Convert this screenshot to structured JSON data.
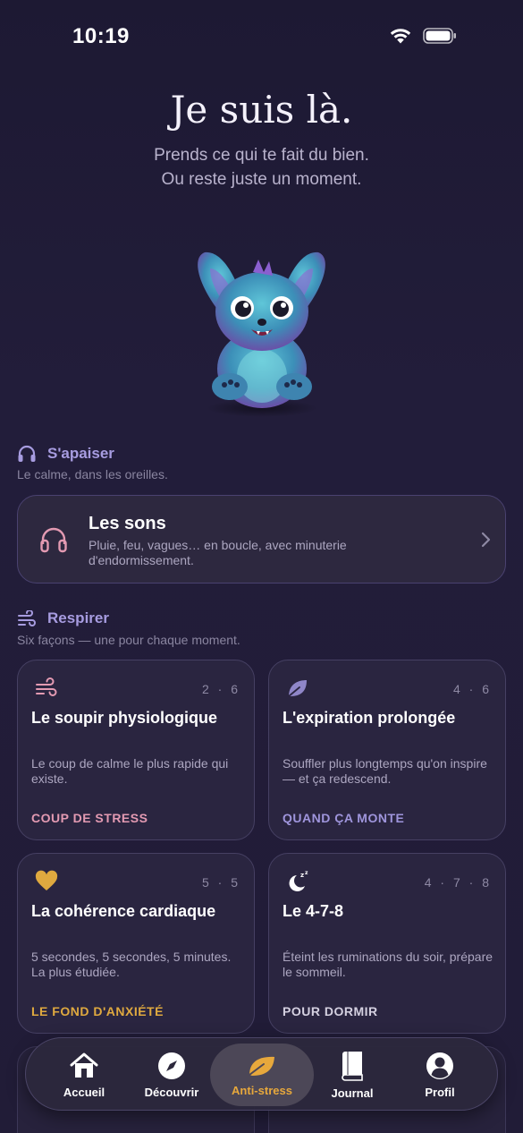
{
  "status": {
    "time": "10:19"
  },
  "hero": {
    "title": "Je suis là.",
    "subtitle_line1": "Prends ce qui te fait du bien.",
    "subtitle_line2": "Ou reste juste un moment."
  },
  "section_soothe": {
    "title": "S'apaiser",
    "subtitle": "Le calme, dans les oreilles.",
    "icon": "headphones-icon"
  },
  "sounds_card": {
    "title": "Les sons",
    "description": "Pluie, feu, vagues… en boucle, avec minuterie d'endormissement."
  },
  "section_breathe": {
    "title": "Respirer",
    "subtitle": "Six façons — une pour chaque moment.",
    "icon": "wind-icon"
  },
  "exercises": [
    {
      "title": "Le soupir physiologique",
      "rhythm": "2 · 6",
      "description": "Le coup de calme le plus rapide qui existe.",
      "tag": "COUP DE STRESS",
      "icon": "wind-icon",
      "tag_color": "#e39ab2"
    },
    {
      "title": "L'expiration prolongée",
      "rhythm": "4 · 6",
      "description": "Souffler plus longtemps qu'on inspire — et ça redescend.",
      "tag": "QUAND ÇA MONTE",
      "icon": "leaf-icon",
      "tag_color": "#9f95dc"
    },
    {
      "title": "La cohérence cardiaque",
      "rhythm": "5 · 5",
      "description": "5 secondes, 5 secondes, 5 minutes. La plus étudiée.",
      "tag": "LE FOND D'ANXIÉTÉ",
      "icon": "heart-icon",
      "tag_color": "#dfa93f"
    },
    {
      "title": "Le 4-7-8",
      "rhythm": "4 · 7 · 8",
      "description": "Éteint les ruminations du soir, prépare le sommeil.",
      "tag": "POUR DORMIR",
      "icon": "moon-sleep-icon",
      "tag_color": "#d4d0e0"
    }
  ],
  "tabbar": {
    "items": [
      {
        "label": "Accueil",
        "icon": "home-icon"
      },
      {
        "label": "Découvrir",
        "icon": "compass-icon"
      },
      {
        "label": "Anti-stress",
        "icon": "leaf-icon",
        "active": true
      },
      {
        "label": "Journal",
        "icon": "book-icon"
      },
      {
        "label": "Profil",
        "icon": "profile-icon"
      }
    ]
  },
  "colors": {
    "background": "#1f1a36",
    "accent_purple": "#a79ce0",
    "accent_gold": "#e7a83c",
    "accent_pink": "#e39ab2"
  }
}
